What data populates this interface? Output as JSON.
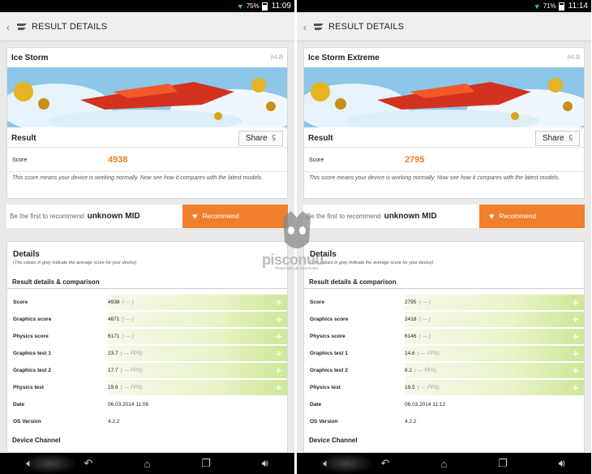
{
  "panels": [
    {
      "status": {
        "battery": "75%",
        "time": "11:09"
      },
      "header_title": "RESULT DETAILS",
      "test_name": "Ice Storm",
      "version": "(v1.2)",
      "result_label": "Result",
      "share_label": "Share",
      "score_label": "Score",
      "score_value": "4938",
      "score_note": "This score means your device is working normally. Now see how it compares with the latest models.",
      "recommend_prompt": "Be the first to recommend",
      "device_name": "unknown MID",
      "recommend_label": "Recommend",
      "details_title": "Details",
      "details_note": "(The values in grey indicate the average score for your device)",
      "details_sub": "Result details & comparison",
      "rows": [
        {
          "label": "Score",
          "value": "4938",
          "extra": "( --- )"
        },
        {
          "label": "Graphics score",
          "value": "4671",
          "extra": "( --- )"
        },
        {
          "label": "Physics score",
          "value": "6171",
          "extra": "( --- )"
        },
        {
          "label": "Graphics test 1",
          "value": "23.7",
          "extra": "( --- FPS)"
        },
        {
          "label": "Graphics test 2",
          "value": "17.7",
          "extra": "( --- FPS)"
        },
        {
          "label": "Physics test",
          "value": "19.6",
          "extra": "( --- FPS)"
        },
        {
          "label": "Date",
          "value": "06.03.2014 11:06",
          "extra": ""
        },
        {
          "label": "OS Version",
          "value": "4.2.2",
          "extra": ""
        }
      ],
      "device_channel": "Device Channel"
    },
    {
      "status": {
        "battery": "71%",
        "time": "11:14"
      },
      "header_title": "RESULT DETAILS",
      "test_name": "Ice Storm Extreme",
      "version": "(v1.2)",
      "result_label": "Result",
      "share_label": "Share",
      "score_label": "Score",
      "score_value": "2795",
      "score_note": "This score means your device is working normally. Now see how it compares with the latest models.",
      "recommend_prompt": "Be the first to recommend",
      "device_name": "unknown MID",
      "recommend_label": "Recommend",
      "details_title": "Details",
      "details_note": "(The values in grey indicate the average score for your device)",
      "details_sub": "Result details & comparison",
      "rows": [
        {
          "label": "Score",
          "value": "2795",
          "extra": "( --- )"
        },
        {
          "label": "Graphics score",
          "value": "2418",
          "extra": "( --- )"
        },
        {
          "label": "Physics score",
          "value": "6146",
          "extra": "( --- )"
        },
        {
          "label": "Graphics test 1",
          "value": "14.6",
          "extra": "( --- FPS)"
        },
        {
          "label": "Graphics test 2",
          "value": "8.2",
          "extra": "( --- FPS)"
        },
        {
          "label": "Physics test",
          "value": "19.5",
          "extra": "( --- FPS)"
        },
        {
          "label": "Date",
          "value": "06.03.2014 11:12",
          "extra": ""
        },
        {
          "label": "OS Version",
          "value": "4.2.2",
          "extra": ""
        }
      ],
      "device_channel": "Device Channel"
    }
  ],
  "watermark": {
    "name": "pisconuu",
    "tagline": "PC&Smart Life Community"
  },
  "colors": {
    "accent": "#f07e2a",
    "score": "#e8822a",
    "highlight": "#cde897",
    "wifi": "#33b5e5"
  },
  "icons": [
    "wifi-icon",
    "battery-icon",
    "back-icon",
    "3dmark-logo-icon",
    "share-icon",
    "heart-icon",
    "plus-icon",
    "volume-icon",
    "nav-back-icon",
    "home-icon",
    "recents-icon"
  ]
}
